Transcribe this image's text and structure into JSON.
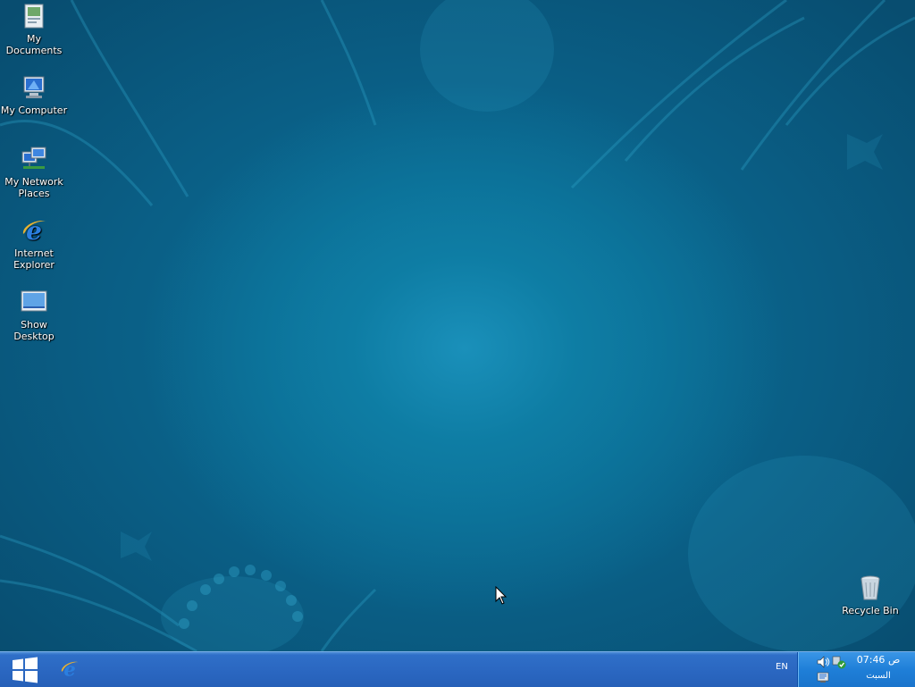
{
  "desktop": {
    "icons": [
      {
        "label": "My Documents",
        "icon": "my-documents-icon"
      },
      {
        "label": "My Computer",
        "icon": "my-computer-icon"
      },
      {
        "label": "My Network Places",
        "icon": "network-places-icon"
      },
      {
        "label": "Internet Explorer",
        "icon": "internet-explorer-icon"
      },
      {
        "label": "Show Desktop",
        "icon": "show-desktop-icon"
      },
      {
        "label": "Recycle Bin",
        "icon": "recycle-bin-icon"
      }
    ]
  },
  "taskbar": {
    "start_icon": "windows-logo-icon",
    "quick_launch": [
      {
        "icon": "internet-explorer-icon"
      }
    ],
    "language": "EN",
    "tray": {
      "icons": [
        "speaker-icon",
        "network-shield-icon",
        "security-center-icon"
      ],
      "time": "07:46 ص",
      "date": "السبت"
    }
  },
  "colors": {
    "desktop_blue": "#0b6f97",
    "taskbar_blue": "#2a66c0",
    "tray_blue": "#1f7fd8"
  }
}
